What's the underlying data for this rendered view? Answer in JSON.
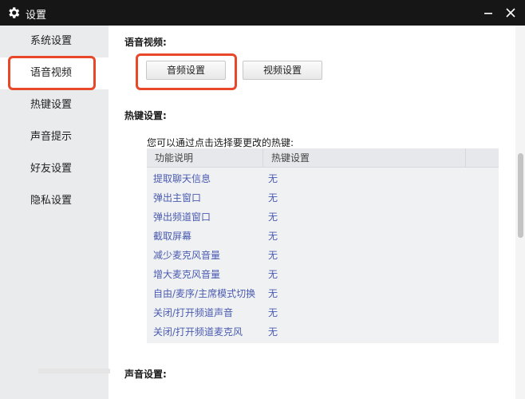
{
  "window": {
    "title": "设置",
    "icon": "gear-icon",
    "min_icon": "minimize-icon",
    "close_icon": "close-icon"
  },
  "sidebar": {
    "items": [
      {
        "label": "系统设置",
        "active": false
      },
      {
        "label": "语音视频",
        "active": true
      },
      {
        "label": "热键设置",
        "active": false
      },
      {
        "label": "声音提示",
        "active": false
      },
      {
        "label": "好友设置",
        "active": false
      },
      {
        "label": "隐私设置",
        "active": false
      }
    ]
  },
  "voice_video": {
    "title": "语音视频:",
    "audio_button": "音频设置",
    "video_button": "视频设置"
  },
  "hotkeys": {
    "title": "热键设置:",
    "hint": "您可以通过点击选择要更改的热键:",
    "columns": [
      "功能说明",
      "热键设置"
    ],
    "rows": [
      {
        "name": "提取聊天信息",
        "key": "无"
      },
      {
        "name": "弹出主窗口",
        "key": "无"
      },
      {
        "name": "弹出频道窗口",
        "key": "无"
      },
      {
        "name": "截取屏幕",
        "key": "无"
      },
      {
        "name": "减少麦克风音量",
        "key": "无"
      },
      {
        "name": "增大麦克风音量",
        "key": "无"
      },
      {
        "name": "自由/麦序/主席模式切换",
        "key": "无"
      },
      {
        "name": "关闭/打开频道声音",
        "key": "无"
      },
      {
        "name": "关闭/打开频道麦克风",
        "key": "无"
      }
    ]
  },
  "sound": {
    "title": "声音设置:"
  },
  "colors": {
    "accent_highlight": "#e8472a",
    "titlebar": "#161616",
    "link_text": "#4a5bb0"
  }
}
